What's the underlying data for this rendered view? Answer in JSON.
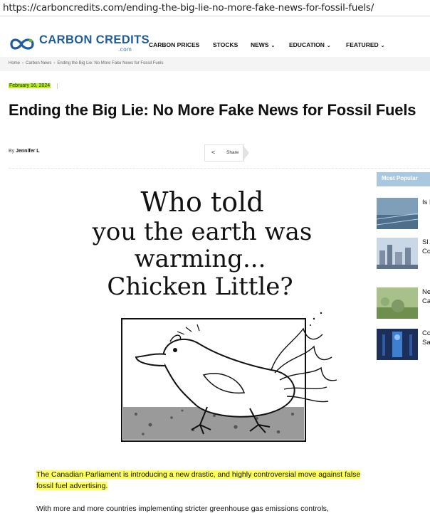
{
  "browser": {
    "url": "https://carboncredits.com/ending-the-big-lie-no-more-fake-news-for-fossil-fuels/"
  },
  "site": {
    "logo_text": "CARBON CREDITS",
    "logo_suffix": ".com",
    "brand_color": "#1f5c99"
  },
  "nav": {
    "items": [
      {
        "label": "CARBON PRICES",
        "has_dropdown": false
      },
      {
        "label": "STOCKS",
        "has_dropdown": false
      },
      {
        "label": "NEWS",
        "has_dropdown": true
      },
      {
        "label": "EDUCATION",
        "has_dropdown": true
      },
      {
        "label": "FEATURED",
        "has_dropdown": true
      }
    ]
  },
  "breadcrumb": {
    "items": [
      "Home",
      "Carbon News",
      "Ending the Big Lie: No More Fake News for Fossil Fuels"
    ]
  },
  "article": {
    "date": "February 16, 2024",
    "title": "Ending the Big Lie: No More Fake News for Fossil Fuels",
    "byline_prefix": "By",
    "author": "Jennifer L",
    "share_label": "Share",
    "cartoon_caption": "Who told you the earth was warming... Chicken Little?",
    "cartoon_lines": [
      "Who told",
      "you the earth was",
      "warming...",
      "Chicken Little?"
    ],
    "lead_paragraph": "The Canadian Parliament is introducing a new drastic, and highly controversial move against false fossil fuel advertising.",
    "next_paragraph": "With more and more countries implementing stricter greenhouse gas emissions controls,",
    "highlight_color": "#ffff55"
  },
  "sidebar": {
    "heading": "Most Popular",
    "items": [
      {
        "text": "Is He Le"
      },
      {
        "text": "Sl Al M Cc"
      },
      {
        "text": "Ne De Ca"
      },
      {
        "text": "Cc Nu Sa Da"
      }
    ]
  }
}
